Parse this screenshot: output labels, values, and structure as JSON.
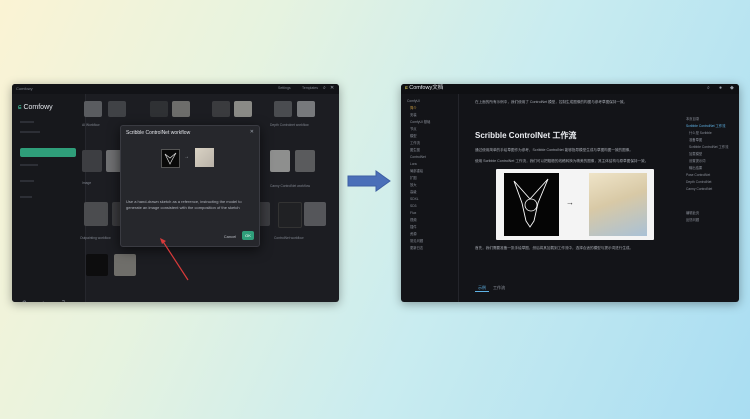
{
  "left_window": {
    "brand": "Comfowy",
    "titlebar_items": [
      "Settings",
      "Templates"
    ],
    "modal": {
      "title": "Scribble ControlNet workflow",
      "description": "Use a hand-drawn sketch as a reference, instructing the model to generate an image consistent with the composition of the sketch",
      "cancel_label": "Cancel",
      "ok_label": "OK"
    },
    "card_labels": [
      "AI Workflow",
      "Scribble ControlNet workflow",
      "Depth Controlnet workflow",
      "Image",
      "Canny ControlNet workflow",
      "Outpainting workflow",
      "Lineart ControlNet workflow",
      "ControlNet workflow"
    ]
  },
  "right_window": {
    "brand": "Comfowy",
    "brand_badge": "文档",
    "intro": "在上面的所有示例中，我们使用了 ControlNet 模型，控制生成图像的构图与参考草图保持一致。",
    "heading": "Scribble ControlNet 工作流",
    "para1": "通过使用简单的手绘草图作为参考，Scribble ControlNet 能够指导模型生成与草图构图一致的图像。",
    "para2": "使用 Scribble ControlNet 工作流，我们可以把粗糙的线稿转换为精美的图像，其主体结构与原草图保持一致。",
    "para3": "首先，我们需要准备一张手绘草图，然后将其加载到工作流中，选择合适的模型与提示词进行生成。",
    "tab_active": "示例",
    "tab_other": "工作流",
    "nav_items": [
      "ComfyUI",
      "简介",
      "安装",
      "ComfyUI 基础",
      "节点",
      "模型",
      "工作流",
      "图生图",
      "ControlNet",
      "Lora",
      "局部重绘",
      "扩图",
      "放大",
      "高级",
      "SDXL",
      "SD3",
      "Flux",
      "视频",
      "插件",
      "资源",
      "常见问题",
      "更新日志"
    ],
    "toc_items": [
      "本页目录",
      "Scribble ControlNet 工作流",
      "什么是 Scribble",
      "准备草图",
      "Scribble ControlNet 工作流",
      "加载模型",
      "设置提示词",
      "输出结果",
      "Pose ControlNet",
      "Depth ControlNet",
      "Canny ControlNet",
      "编辑此页",
      "反馈问题"
    ]
  },
  "arrow_color": "#4a6fb8"
}
